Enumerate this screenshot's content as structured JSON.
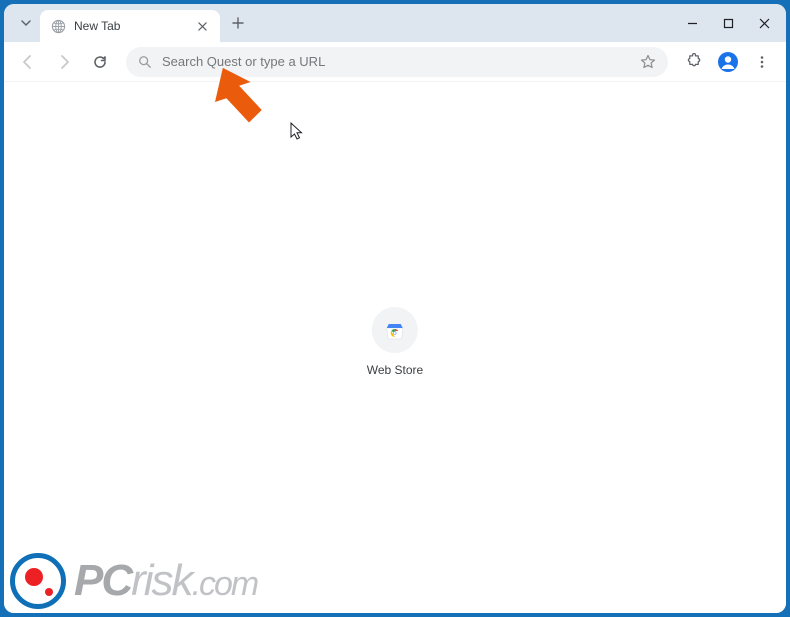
{
  "tab": {
    "title": "New Tab"
  },
  "omnibox": {
    "placeholder": "Search Quest or type a URL"
  },
  "shortcut": {
    "label": "Web Store"
  },
  "watermark": {
    "pc": "PC",
    "risk": "risk",
    "com": ".com"
  }
}
